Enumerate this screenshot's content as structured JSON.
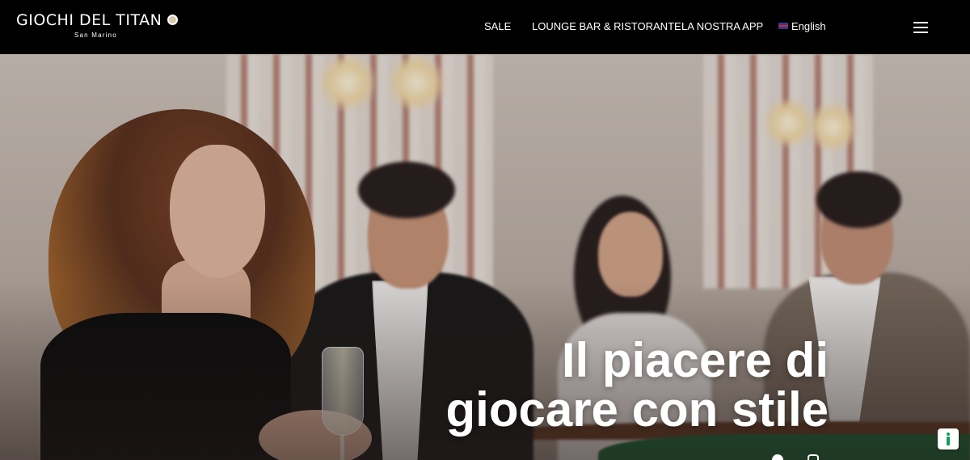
{
  "header": {
    "logo_text": "GIOCHI DEL TITAN",
    "logo_subtext": "San Marino",
    "nav": {
      "sale": "SALE",
      "lounge": "LOUNGE BAR & RISTORANTE",
      "app": "LA NOSTRA APP",
      "language": "English"
    }
  },
  "hero": {
    "title_line1": "Il piacere di",
    "title_line2": "giocare con stile"
  },
  "colors": {
    "header_bg": "#000000",
    "hero_text": "#ffffff",
    "accessibility_accent": "#12a05c"
  }
}
